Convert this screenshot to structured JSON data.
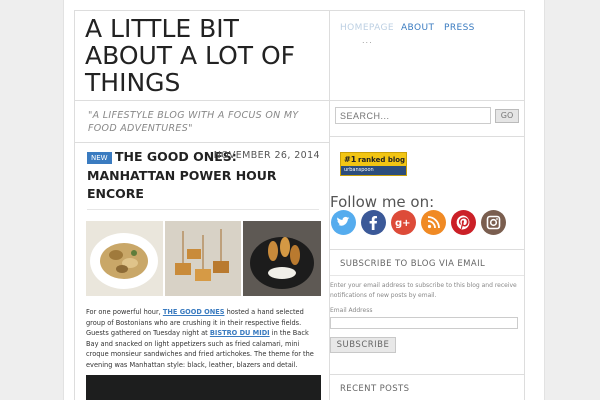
{
  "site": {
    "title": "A LITTLE BIT ABOUT A LOT OF THINGS",
    "tagline": "\"A LIFESTYLE BLOG WITH A FOCUS ON MY FOOD ADVENTURES\""
  },
  "nav": {
    "items": [
      {
        "label": "HOMEPAGE"
      },
      {
        "label": "ABOUT"
      },
      {
        "label": "PRESS"
      }
    ],
    "more": "..."
  },
  "post": {
    "badge": "NEW",
    "title": "THE GOOD ONES: MANHATTAN POWER HOUR ENCORE",
    "date": "NOVEMBER 26, 2014",
    "body": {
      "t1": "For one powerful hour, ",
      "link1": "THE GOOD ONES",
      "t2": " hosted a hand selected group of Bostonians who are crushing it in their respective fields. Guests gathered on Tuesday night at ",
      "link2": "BISTRO DU MIDI",
      "t3": " in the Back Bay and snacked on light appetizers such as fried calamari, mini croque monsieur sandwiches and fried artichokes. The theme for the evening was Manhattan style: black, leather, blazers and detail."
    }
  },
  "search": {
    "placeholder": "SEARCH...",
    "button": "GO"
  },
  "ranked_badge": {
    "number": "#1",
    "text": "ranked blog",
    "brand": "urbanspoon"
  },
  "follow": {
    "heading": "Follow me on:",
    "icons": [
      "twitter-icon",
      "facebook-icon",
      "google-plus-icon",
      "rss-icon",
      "pinterest-icon",
      "instagram-icon"
    ]
  },
  "subscribe": {
    "heading": "SUBSCRIBE TO BLOG VIA EMAIL",
    "text": "Enter your email address to subscribe to this blog and receive notifications of new posts by email.",
    "email_label": "Email Address",
    "button": "SUBSCRIBE"
  },
  "recent": {
    "heading": "RECENT POSTS"
  },
  "colors": {
    "link": "#3a7bc0",
    "ranked": "#f2c513"
  }
}
